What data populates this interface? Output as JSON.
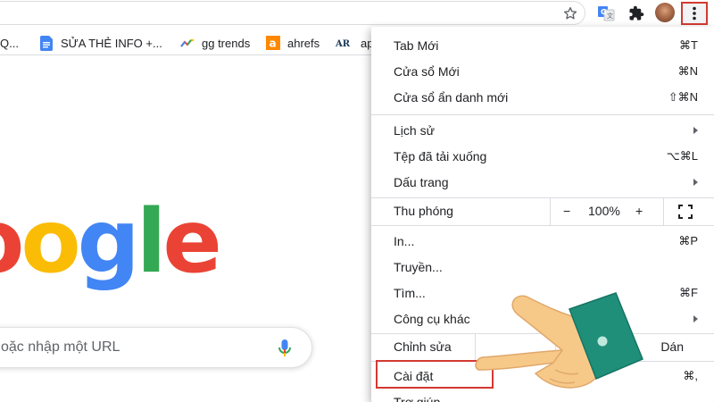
{
  "toolbar": {
    "icons": [
      "star-icon",
      "translate-icon",
      "extensions-icon",
      "avatar",
      "kebab-menu-icon"
    ],
    "highlight_color": "#d33a32"
  },
  "bookmarks": [
    {
      "label": "Q...",
      "icon": "partial"
    },
    {
      "label": "SỬA THẺ INFO +...",
      "icon": "docs-icon"
    },
    {
      "label": "gg trends",
      "icon": "trends-icon"
    },
    {
      "label": "ahrefs",
      "icon": "ahrefs-icon"
    },
    {
      "label": "ap",
      "icon": "ar-icon"
    }
  ],
  "main": {
    "logo_text": "oogle",
    "search_placeholder": "oặc nhập một URL"
  },
  "menu": {
    "new_tab": {
      "label": "Tab Mới",
      "shortcut": "⌘T"
    },
    "new_window": {
      "label": "Cửa sổ Mới",
      "shortcut": "⌘N"
    },
    "incognito": {
      "label": "Cửa sổ ẩn danh mới",
      "shortcut": "⇧⌘N"
    },
    "history": {
      "label": "Lịch sử"
    },
    "downloads": {
      "label": "Tệp đã tải xuống",
      "shortcut": "⌥⌘L"
    },
    "bookmarks": {
      "label": "Dấu trang"
    },
    "zoom": {
      "label": "Thu phóng",
      "minus": "−",
      "level": "100%",
      "plus": "+"
    },
    "print": {
      "label": "In...",
      "shortcut": "⌘P"
    },
    "cast": {
      "label": "Truyền..."
    },
    "find": {
      "label": "Tìm...",
      "shortcut": "⌘F"
    },
    "more_tools": {
      "label": "Công cụ khác"
    },
    "edit": {
      "label": "Chỉnh sửa",
      "paste": "Dán"
    },
    "settings": {
      "label": "Cài đặt",
      "shortcut": "⌘,"
    },
    "help": {
      "label": "Trợ giúp"
    }
  }
}
